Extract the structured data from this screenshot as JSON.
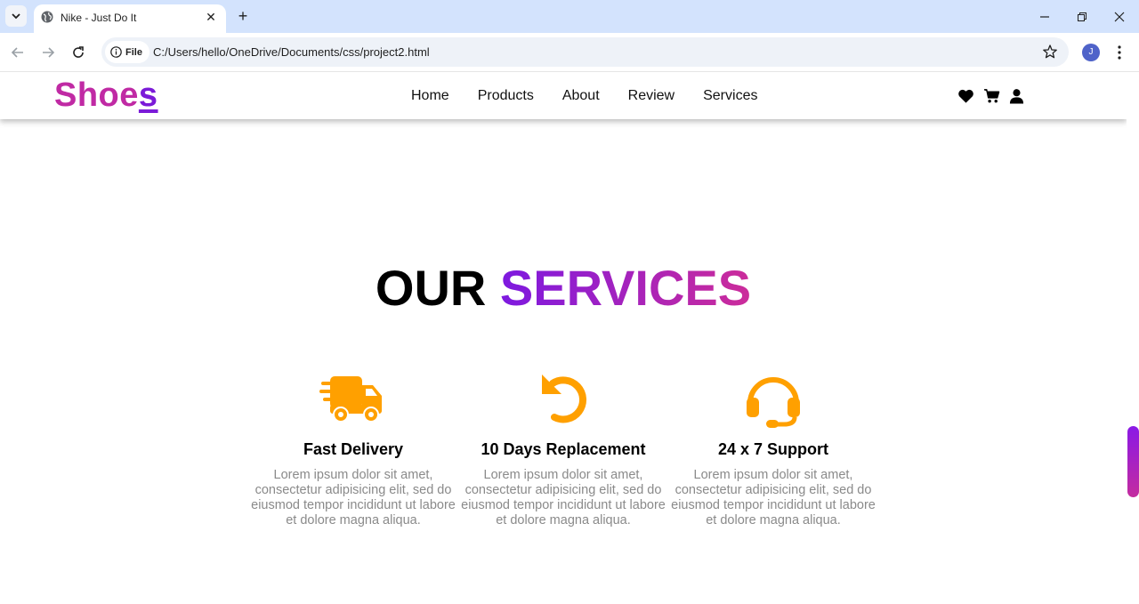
{
  "browser": {
    "tab_title": "Nike - Just Do It",
    "url_scheme_label": "File",
    "url": "C:/Users/hello/OneDrive/Documents/css/project2.html",
    "profile_initial": "J"
  },
  "site": {
    "logo_main": "Shoe",
    "logo_last": "s",
    "nav": [
      "Home",
      "Products",
      "About",
      "Review",
      "Services"
    ],
    "header_icons": [
      "heart-icon",
      "cart-icon",
      "user-icon"
    ]
  },
  "services": {
    "title_plain": "OUR",
    "title_accent": "SERVICES",
    "items": [
      {
        "icon": "truck-fast-icon",
        "title": "Fast Delivery",
        "text": "Lorem ipsum dolor sit amet, consectetur adipisicing elit, sed do eiusmod tempor incididunt ut labore et dolore magna aliqua."
      },
      {
        "icon": "rotate-left-icon",
        "title": "10 Days Replacement",
        "text": "Lorem ipsum dolor sit amet, consectetur adipisicing elit, sed do eiusmod tempor incididunt ut labore et dolore magna aliqua."
      },
      {
        "icon": "headset-icon",
        "title": "24 x 7 Support",
        "text": "Lorem ipsum dolor sit amet, consectetur adipisicing elit, sed do eiusmod tempor incididunt ut labore et dolore magna aliqua."
      }
    ]
  },
  "colors": {
    "brand_pink": "#c02aa4",
    "brand_purple": "#7b1bd8",
    "icon_orange": "#ffa000",
    "body_text_gray": "#8a8a8a"
  }
}
